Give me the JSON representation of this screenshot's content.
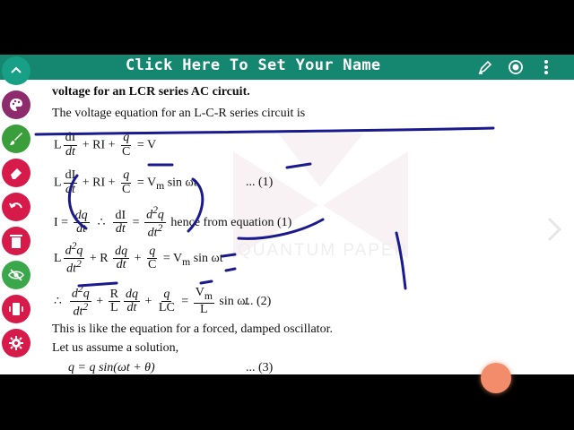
{
  "app_bar": {
    "title": "Click Here To Set Your Name",
    "icons": [
      "pen-icon",
      "record-icon",
      "more-vert-icon"
    ]
  },
  "toolbar": {
    "items": [
      {
        "name": "collapse-up-icon",
        "color": "#17a085"
      },
      {
        "name": "palette-icon",
        "color": "#8e2b6c"
      },
      {
        "name": "brush-icon",
        "color": "#3a9e3a"
      },
      {
        "name": "eraser-icon",
        "color": "#d61a4a"
      },
      {
        "name": "undo-icon",
        "color": "#d61a4a"
      },
      {
        "name": "delete-icon",
        "color": "#d61a4a"
      },
      {
        "name": "hide-icon",
        "color": "#3aa84a"
      },
      {
        "name": "vibrate-icon",
        "color": "#d61a4a"
      },
      {
        "name": "settings-icon",
        "color": "#d61a4a"
      }
    ]
  },
  "watermark": {
    "text": "QUANTUM PAPER"
  },
  "document": {
    "heading": "voltage for an LCR series AC circuit.",
    "intro": "The voltage equation for an L-C-R series circuit is",
    "eq1": {
      "L": "L",
      "dI": "dI",
      "dt": "dt",
      "plus_ri": "+ RI +",
      "q": "q",
      "C": "C",
      "eq_v": "= V"
    },
    "eq2": {
      "L": "L",
      "dI": "dI",
      "dt": "dt",
      "plus_ri": "+ RI +",
      "q": "q",
      "C": "C",
      "rhs": "= V",
      "m": "m",
      "sin": "sin ωt",
      "ref": "... (1)"
    },
    "eq3": {
      "I": "I =",
      "dq": "dq",
      "dt": "dt",
      "therefore": "∴",
      "dI": "dI",
      "dt2": "dt",
      "eq": "=",
      "d2q": "d",
      "sq": "2",
      "q": "q",
      "dt_sq": "dt",
      "sq2": "2",
      "tail": "hence from equation (1)"
    },
    "eq4": {
      "L": "L",
      "d2q": "d",
      "sq": "2",
      "q": "q",
      "dt": "dt",
      "sq2": "2",
      "plus_r": "+ R",
      "dq": "dq",
      "dt1": "dt",
      "plus": "+",
      "q2": "q",
      "C": "C",
      "rhs": "= V",
      "m": "m",
      "sin": "sin ωt"
    },
    "eq5": {
      "therefore": "∴",
      "d2q": "d",
      "sq": "2",
      "q": "q",
      "dt": "dt",
      "sq2": "2",
      "plus": "+",
      "R": "R",
      "L": "L",
      "dq": "dq",
      "dt1": "dt",
      "plus2": "+",
      "q2": "q",
      "LC": "LC",
      "eq": "=",
      "Vm": "V",
      "m": "m",
      "L2": "L",
      "sin": "sin ωt",
      "ref": "... (2)"
    },
    "line6": "This is like the equation for a forced, damped oscillator.",
    "line7": "Let us assume a solution,",
    "line8": "q = q  sin(ωt + θ)",
    "line8_ref": "... (3)"
  }
}
